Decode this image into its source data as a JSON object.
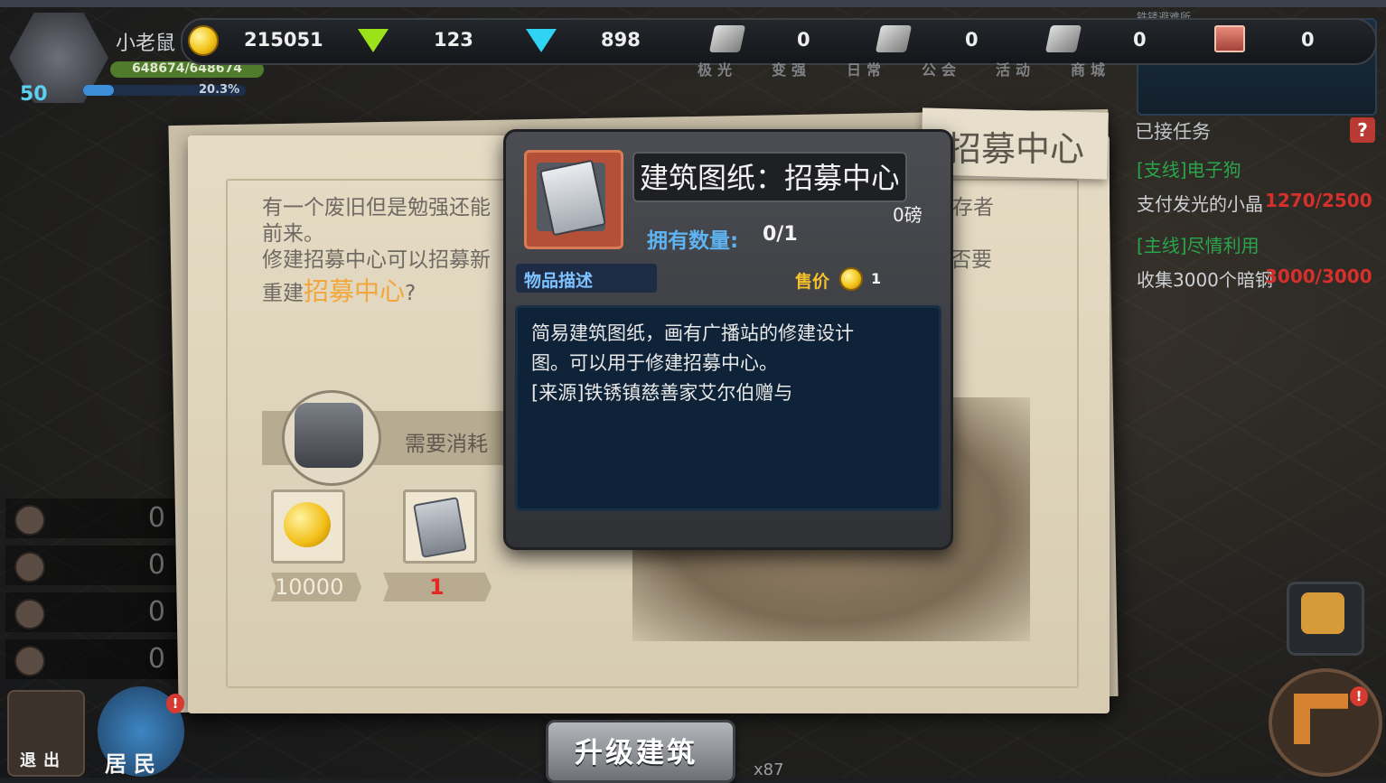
{
  "hud": {
    "player_name": "小老鼠",
    "level": "50",
    "hp_text": "648674/648674",
    "exp_text": "20.3%"
  },
  "resources": [
    {
      "icon": "gold-coin-icon",
      "value": "215051"
    },
    {
      "icon": "green-gem-icon",
      "value": "123"
    },
    {
      "icon": "blue-diamond-icon",
      "value": "898"
    },
    {
      "icon": "crystal-icon",
      "value": "0"
    },
    {
      "icon": "iron-bar-icon",
      "value": "0"
    },
    {
      "icon": "steel-plate-icon",
      "value": "0"
    },
    {
      "icon": "chest-icon",
      "value": "0"
    }
  ],
  "nav_labels": [
    "极光",
    "变强",
    "日常",
    "公会",
    "活动",
    "商城"
  ],
  "minimap_label": "铁锈避难所",
  "left_counters": [
    "0",
    "0",
    "0",
    "0"
  ],
  "paper": {
    "title": "招募中心",
    "line1": "有一个废旧但是勉强还能",
    "line1_right": "存者",
    "line2": "前来。",
    "line3": "修建招募中心可以招募新",
    "line3_right": "否要",
    "line4_prefix": "重建",
    "line4_highlight": "招募中心",
    "line4_suffix": "?",
    "consume_label": "需要消耗",
    "cost_gold": "10000",
    "cost_blueprint": "1"
  },
  "tooltip": {
    "title": "建筑图纸：招募中心",
    "weight": "0磅",
    "own_label": "拥有数量:",
    "own_value": "0/1",
    "desc_tab": "物品描述",
    "price_label": "售价",
    "price_value": "1",
    "desc_lines": [
      "简易建筑图纸，画有广播站的修建设计",
      "图。可以用于修建招募中心。",
      "[来源]铁锈镇慈善家艾尔伯赠与"
    ]
  },
  "bottom": {
    "upgrade_label": "升级建筑",
    "stack_count": "x87",
    "exit_label": "退出",
    "residents_label": "居民"
  },
  "quests": {
    "header": "已接任务",
    "help": "?",
    "items": [
      {
        "tag": "[支线]电子狗",
        "desc": "支付发光的小晶",
        "progress": "1270/2500"
      },
      {
        "tag": "[主线]尽情利用",
        "desc": "收集3000个暗钢",
        "progress": "3000/3000"
      }
    ]
  },
  "colors": {
    "accent_orange": "#f3a63b",
    "own_blue": "#5eb3f2",
    "price_gold": "#f6c02a",
    "quest_green": "#2aa54b",
    "quest_red": "#d5302b"
  }
}
